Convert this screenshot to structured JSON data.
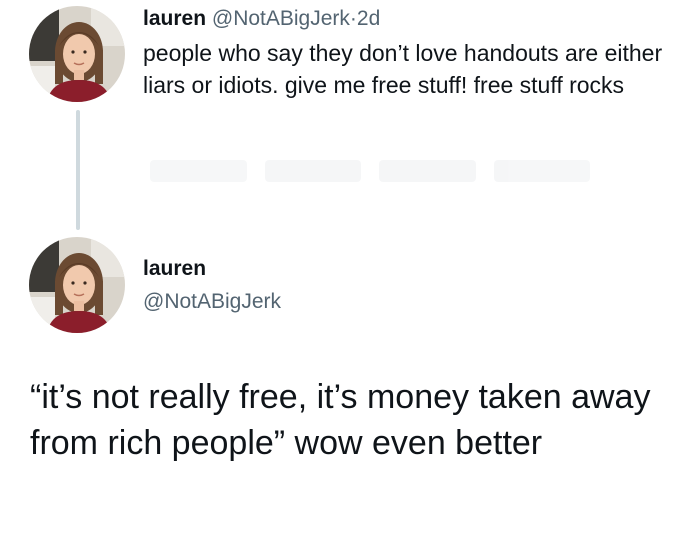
{
  "tweet_1": {
    "display_name": "lauren",
    "handle": "@NotABigJerk",
    "separator": "·",
    "time": "2d",
    "text": "people who say they don’t love handouts are either liars or idiots. give me free stuff! free stuff rocks"
  },
  "tweet_2": {
    "display_name": "lauren",
    "handle": "@NotABigJerk",
    "text": "“it’s not really free, it’s money taken away from rich people” wow even better"
  },
  "colors": {
    "text": "#0f1419",
    "secondary": "#536471",
    "thread_line": "#cfd9de"
  }
}
